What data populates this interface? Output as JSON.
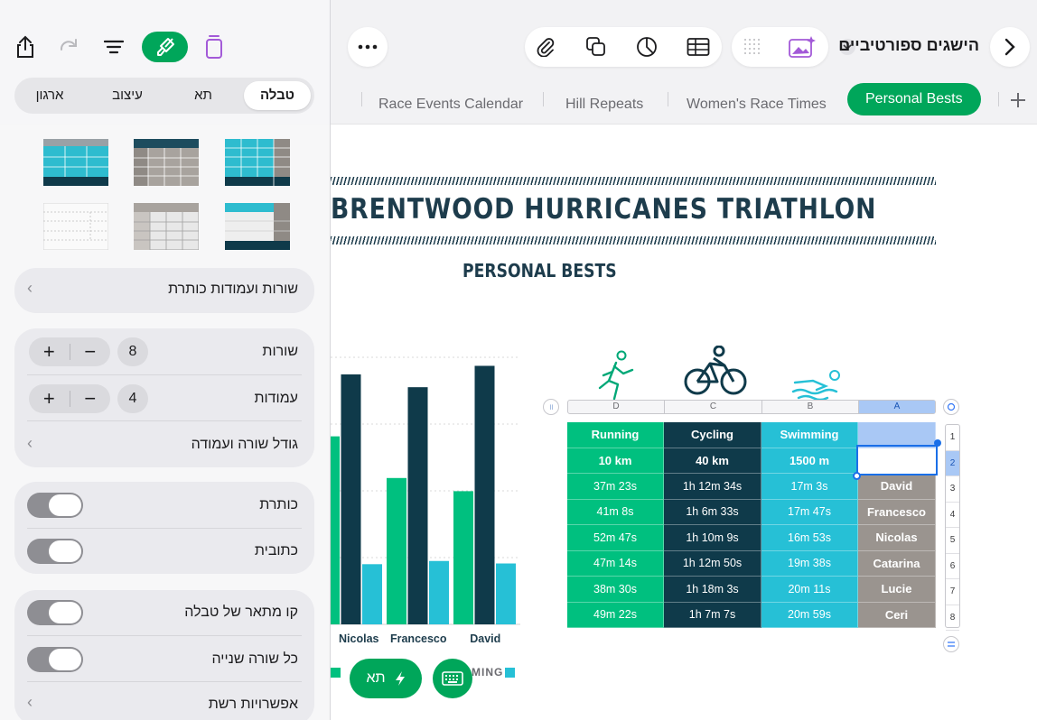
{
  "toolbar": {
    "doc_title": "הישגים ספורטיביים"
  },
  "sheet_tabs": [
    {
      "label": "Race Events Calendar"
    },
    {
      "label": "Hill Repeats"
    },
    {
      "label": "Women's Race Times"
    },
    {
      "label": "Personal Bests"
    }
  ],
  "canvas": {
    "title": "BRENTWOOD HURRICANES TRIATHLON",
    "subtitle": "PERSONAL BESTS"
  },
  "chart_data": {
    "type": "bar",
    "categories": [
      "Nicolas",
      "Francesco",
      "David"
    ],
    "series": [
      {
        "name": "Running",
        "values": [
          52.8,
          41.1,
          37.4
        ]
      },
      {
        "name": "Cycling",
        "values": [
          70.2,
          66.6,
          72.6
        ]
      },
      {
        "name": "Swimming",
        "values": [
          16.9,
          17.8,
          17.1
        ]
      }
    ],
    "legend_visible_text": "MING",
    "colors": {
      "Running": "#00c07f",
      "Cycling": "#0f3a4a",
      "Swimming": "#26c0d6"
    }
  },
  "table": {
    "column_letters": [
      "A",
      "B",
      "C",
      "D"
    ],
    "row_numbers": [
      "1",
      "2",
      "3",
      "4",
      "5",
      "6",
      "7",
      "8"
    ],
    "columns": [
      {
        "header": "Running",
        "subheader": "10 km",
        "values": [
          "37m 23s",
          "41m 8s",
          "52m 47s",
          "47m 14s",
          "38m 30s",
          "49m 22s"
        ]
      },
      {
        "header": "Cycling",
        "subheader": "40 km",
        "values": [
          "1h 12m 34s",
          "1h 6m 33s",
          "1h 10m 9s",
          "1h 12m 50s",
          "1h 18m 3s",
          "1h 7m 7s"
        ]
      },
      {
        "header": "Swimming",
        "subheader": "1500 m",
        "values": [
          "17m 3s",
          "17m 47s",
          "16m 53s",
          "19m 38s",
          "20m 11s",
          "20m 59s"
        ]
      }
    ],
    "names": [
      "David",
      "Francesco",
      "Nicolas",
      "Catarina",
      "Lucie",
      "Ceri"
    ],
    "colors": {
      "running": "#00c07f",
      "cycling": "#0f3a4a",
      "swimming": "#26c0d6",
      "names": "#9a948f"
    }
  },
  "sidebar": {
    "tabs": [
      {
        "label": "טבלה"
      },
      {
        "label": "תא"
      },
      {
        "label": "עיצוב"
      },
      {
        "label": "ארגון"
      }
    ],
    "header_rows_cols": "שורות ועמודות כותרת",
    "rows_label": "שורות",
    "rows_value": "8",
    "columns_label": "עמודות",
    "columns_value": "4",
    "row_col_size": "גודל שורה ועמודה",
    "title_label": "כותרת",
    "caption_label": "כתובית",
    "outline_label": "קו מתאר של טבלה",
    "alternating_label": "כל שורה שנייה",
    "grid_options": "אפשרויות רשת"
  },
  "bottom": {
    "cell_button": "תא"
  }
}
